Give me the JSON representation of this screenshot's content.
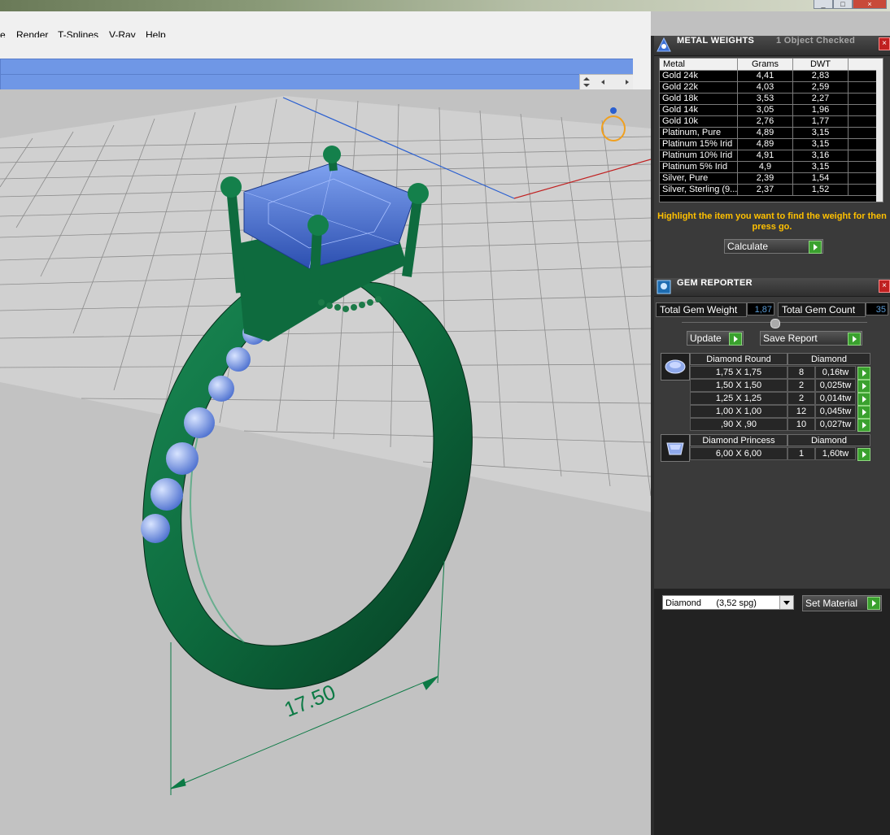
{
  "menu": {
    "items": [
      "e",
      "Render",
      "T-Splines",
      "V-Ray",
      "Help"
    ]
  },
  "window_controls": [
    "minimize",
    "maximize",
    "close"
  ],
  "viewport": {
    "dimension_label": "17.50"
  },
  "metal_panel": {
    "title": "METAL WEIGHTS",
    "status": "1 Object Checked",
    "columns": [
      "Metal",
      "Grams",
      "DWT"
    ],
    "rows": [
      {
        "metal": "Gold 24k",
        "grams": "4,41",
        "dwt": "2,83"
      },
      {
        "metal": "Gold 22k",
        "grams": "4,03",
        "dwt": "2,59"
      },
      {
        "metal": "Gold 18k",
        "grams": "3,53",
        "dwt": "2,27"
      },
      {
        "metal": "Gold 14k",
        "grams": "3,05",
        "dwt": "1,96"
      },
      {
        "metal": "Gold 10k",
        "grams": "2,76",
        "dwt": "1,77"
      },
      {
        "metal": "Platinum, Pure",
        "grams": "4,89",
        "dwt": "3,15"
      },
      {
        "metal": "Platinum 15% Irid",
        "grams": "4,89",
        "dwt": "3,15"
      },
      {
        "metal": "Platinum 10% Irid",
        "grams": "4,91",
        "dwt": "3,16"
      },
      {
        "metal": "Platinum 5% Irid",
        "grams": "4,9",
        "dwt": "3,15"
      },
      {
        "metal": "Silver, Pure",
        "grams": "2,39",
        "dwt": "1,54"
      },
      {
        "metal": "Silver, Sterling (9...",
        "grams": "2,37",
        "dwt": "1,52"
      }
    ],
    "hint": "Highlight the item you want to find the weight for then press go.",
    "calculate_label": "Calculate"
  },
  "gem_panel": {
    "title": "GEM REPORTER",
    "total_weight_label": "Total Gem Weight",
    "total_weight_value": "1,87",
    "total_count_label": "Total Gem Count",
    "total_count_value": "35",
    "update_label": "Update",
    "save_label": "Save Report",
    "groups": [
      {
        "shape": "Diamond Round",
        "material": "Diamond",
        "rows": [
          {
            "size": "1,75 X 1,75",
            "count": "8",
            "weight": "0,16tw"
          },
          {
            "size": "1,50 X 1,50",
            "count": "2",
            "weight": "0,025tw"
          },
          {
            "size": "1,25 X 1,25",
            "count": "2",
            "weight": "0,014tw"
          },
          {
            "size": "1,00 X 1,00",
            "count": "12",
            "weight": "0,045tw"
          },
          {
            "size": ",90 X ,90",
            "count": "10",
            "weight": "0,027tw"
          }
        ]
      },
      {
        "shape": "Diamond Princess",
        "material": "Diamond",
        "rows": [
          {
            "size": "6,00 X 6,00",
            "count": "1",
            "weight": "1,60tw"
          }
        ]
      }
    ],
    "material_select": "Diamond      (3,52 spg)",
    "set_material_label": "Set Material"
  },
  "colors": {
    "ring": "#0f6a3e",
    "stone": "#3d63c8",
    "panel": "#3a3a3a",
    "hint": "#ffc000",
    "command_bar": "#6f97e6"
  }
}
